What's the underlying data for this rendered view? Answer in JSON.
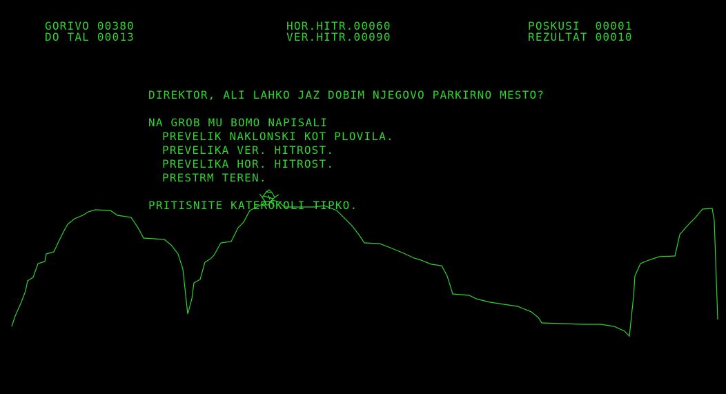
{
  "hud": {
    "fuel_label": "GORIVO",
    "fuel_value": "00380",
    "altitude_label": "DO TAL",
    "altitude_value": "00013",
    "hspeed_label": "HOR.HITR.",
    "hspeed_value": "00060",
    "vspeed_label": "VER.HITR.",
    "vspeed_value": "00090",
    "attempts_label": "POSKUSI",
    "attempts_value": "00001",
    "score_label": "REZULTAT",
    "score_value": "00010"
  },
  "message": {
    "director_line": "DIREKTOR, ALI LAHKO JAZ DOBIM NJEGOVO PARKIRNO MESTO?",
    "epitaph_heading": "NA GROB MU BOMO NAPISALI",
    "reasons": [
      "PREVELIK NAKLONSKI KOT PLOVILA.",
      "PREVELIKA VER. HITROST.",
      "PREVELIKA HOR. HITROST.",
      "PRESTRM TEREN."
    ],
    "prompt": "PRITISNITE KATEROKOLI TIPKO."
  },
  "colors": {
    "phosphor": "#2fd42f",
    "background": "#000000"
  },
  "icons": {
    "lander": "crashed-lander-icon"
  }
}
